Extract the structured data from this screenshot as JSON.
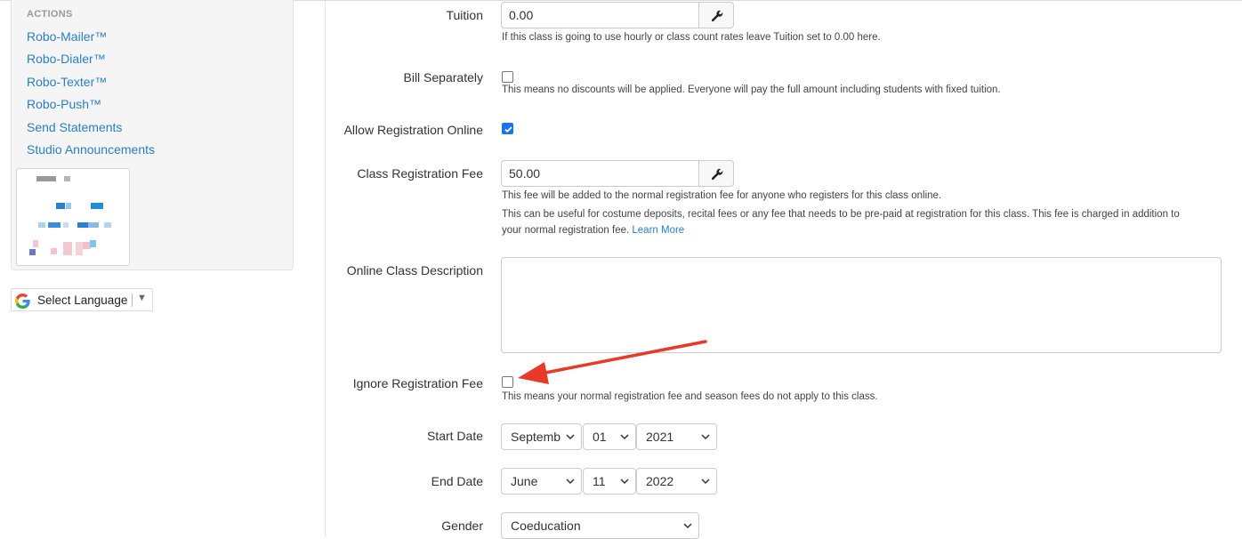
{
  "sidebar": {
    "heading": "ACTIONS",
    "links": [
      {
        "label": "Robo-Mailer™"
      },
      {
        "label": "Robo-Dialer™"
      },
      {
        "label": "Robo-Texter™"
      },
      {
        "label": "Robo-Push™"
      },
      {
        "label": "Send Statements"
      },
      {
        "label": "Studio Announcements"
      }
    ],
    "translate": {
      "label": "Select Language",
      "arrow": "▼",
      "icon": "google-g-icon"
    }
  },
  "form": {
    "tuition": {
      "label": "Tuition",
      "value": "0.00",
      "help": "If this class is going to use hourly or class count rates leave Tuition set to 0.00 here.",
      "button_icon": "wrench-icon"
    },
    "bill_separately": {
      "label": "Bill Separately",
      "checked": false,
      "help": "This means no discounts will be applied. Everyone will pay the full amount including students with fixed tuition."
    },
    "allow_registration_online": {
      "label": "Allow Registration Online",
      "checked": true
    },
    "class_registration_fee": {
      "label": "Class Registration Fee",
      "value": "50.00",
      "button_icon": "wrench-icon",
      "help_line1": "This fee will be added to the normal registration fee for anyone who registers for this class online.",
      "help_line2": "This can be useful for costume deposits, recital fees or any fee that needs to be pre-paid at registration for this class. This fee is charged in addition to",
      "help_line3": "your normal registration fee.",
      "learn_more": "Learn More"
    },
    "online_class_description": {
      "label": "Online Class Description",
      "value": ""
    },
    "ignore_registration_fee": {
      "label": "Ignore Registration Fee",
      "checked": false,
      "help": "This means your normal registration fee and season fees do not apply to this class."
    },
    "start_date": {
      "label": "Start Date",
      "month": "Septemb",
      "day": "01",
      "year": "2021"
    },
    "end_date": {
      "label": "End Date",
      "month": "June",
      "day": "11",
      "year": "2022"
    },
    "gender": {
      "label": "Gender",
      "value": "Coeducation"
    }
  },
  "colors": {
    "link": "#2a7fc4",
    "checkbox_checked": "#1a73e8",
    "annotation_arrow": "#e8392b"
  }
}
